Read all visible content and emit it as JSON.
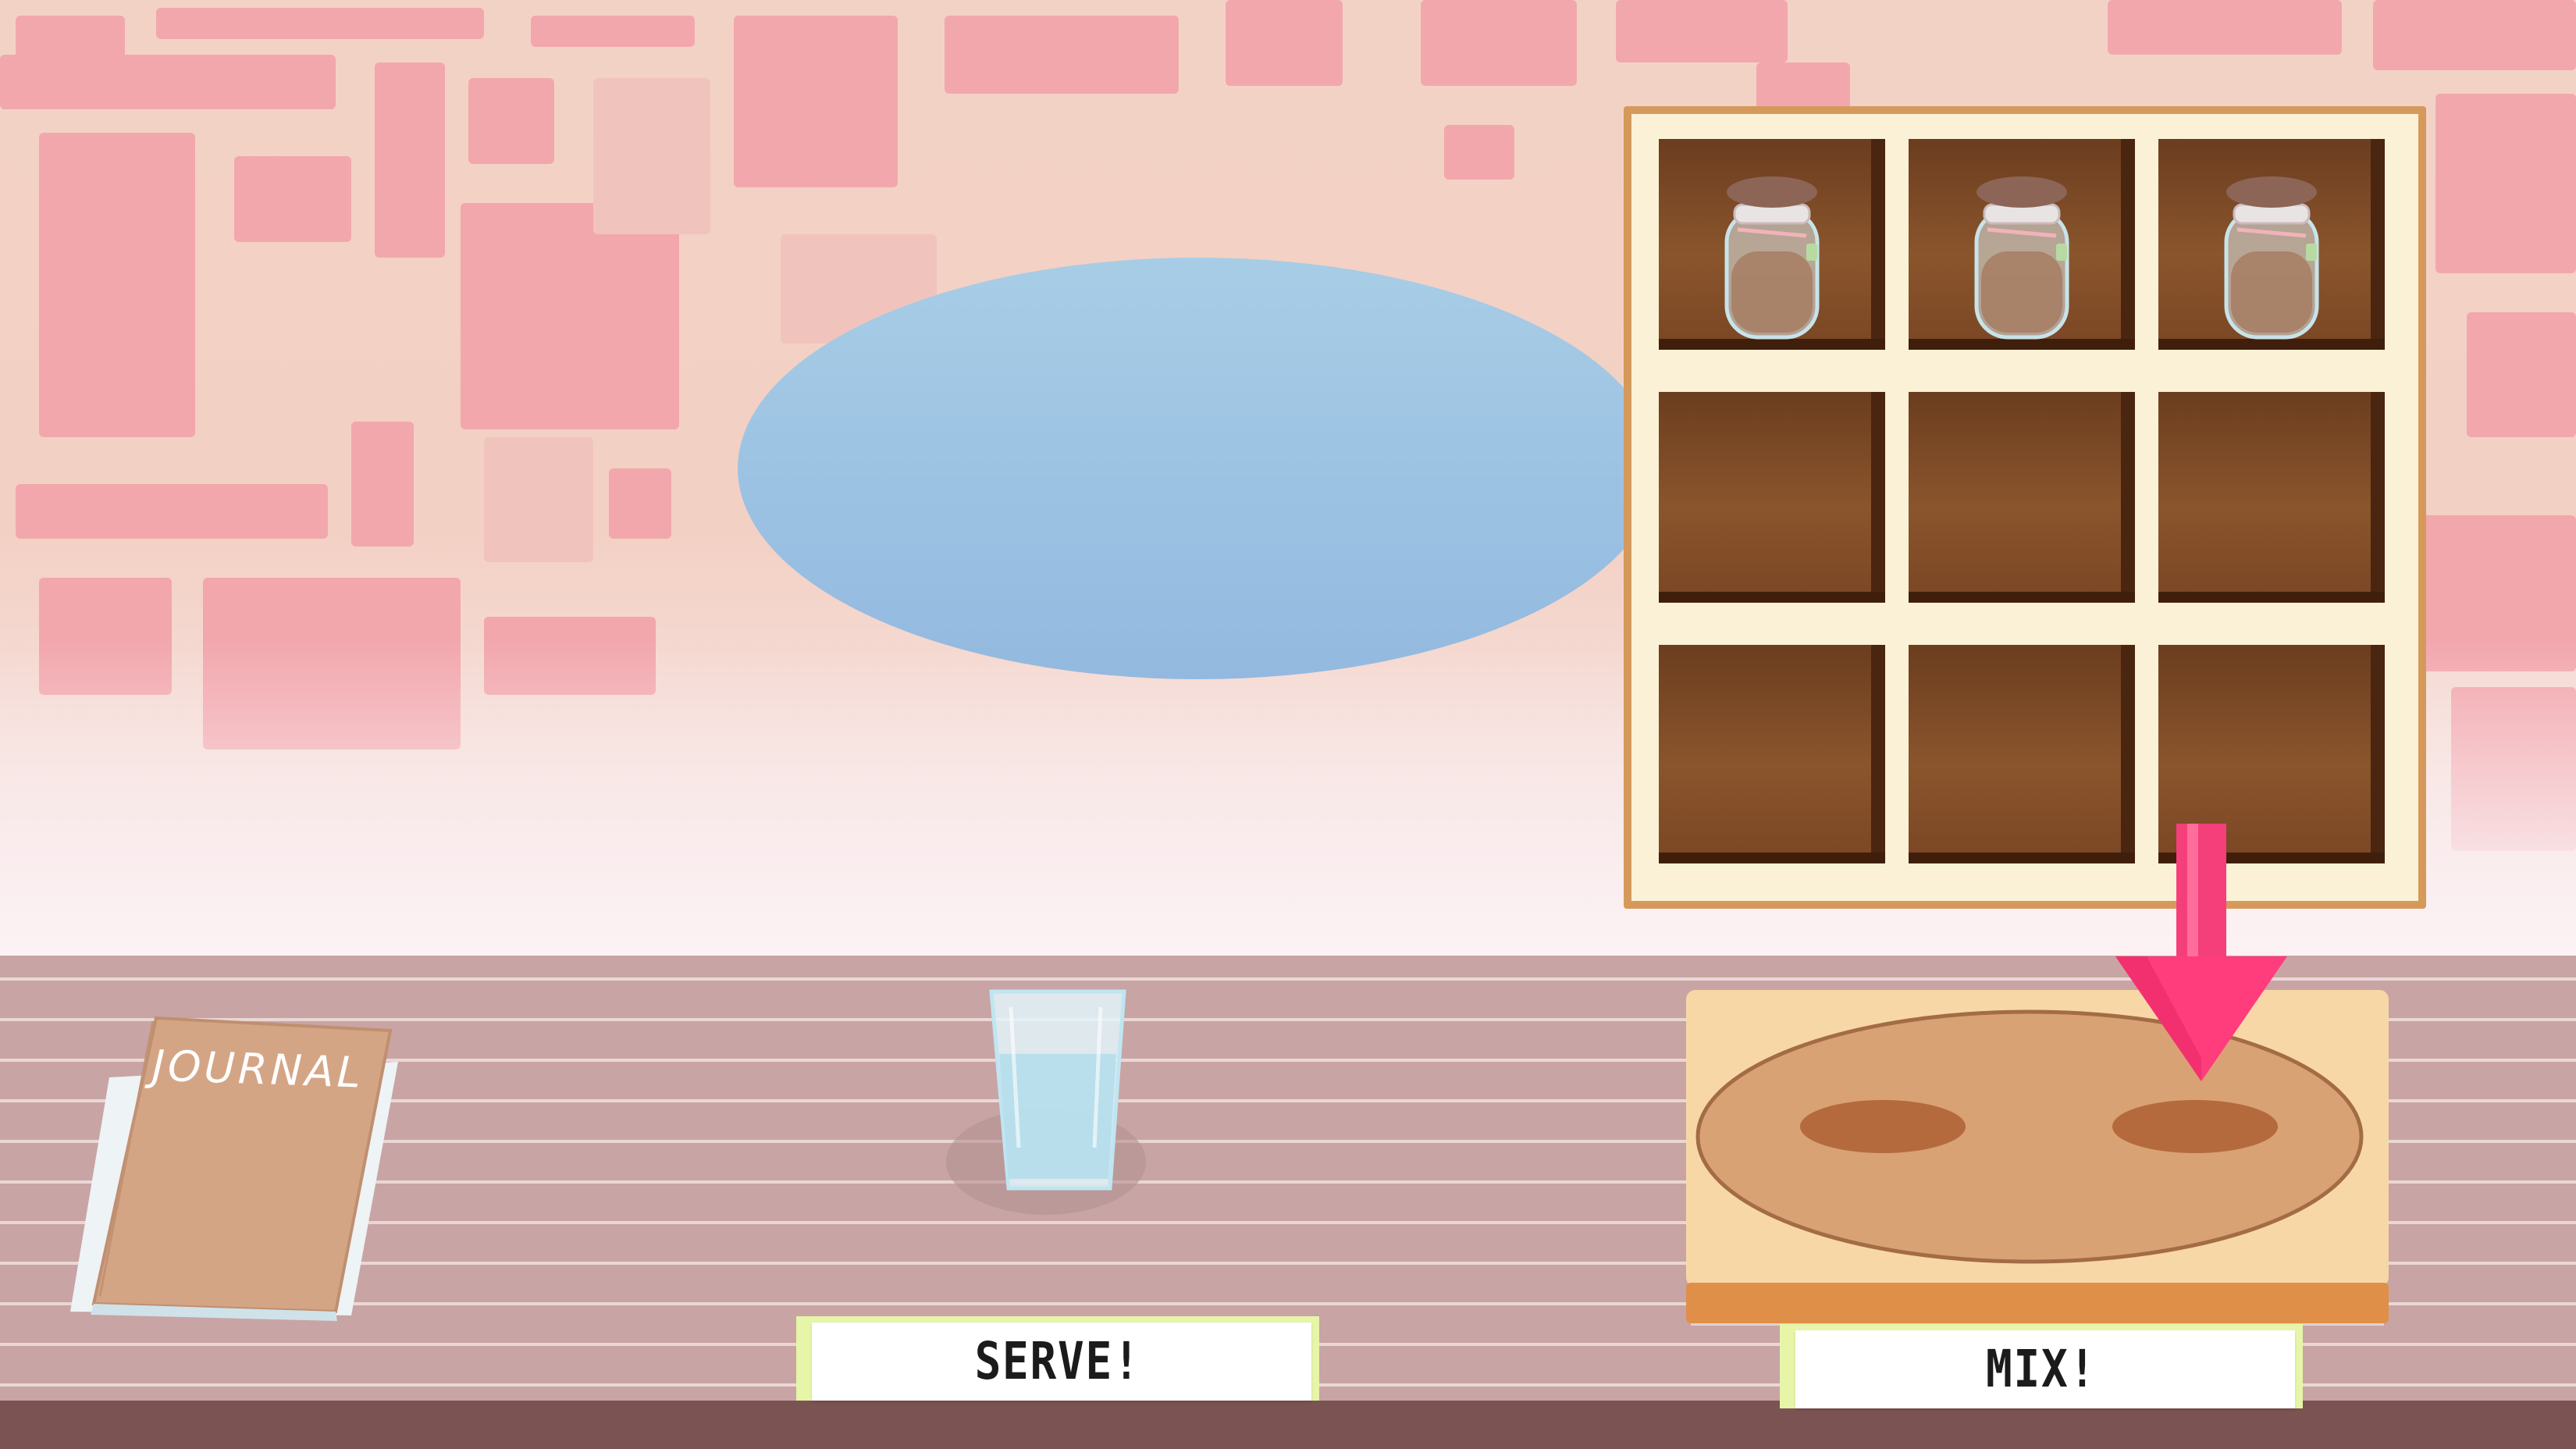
{
  "journal": {
    "title": "JOURNAL"
  },
  "buttons": {
    "serve": "SERVE!",
    "mix": "MIX!"
  },
  "shelf": {
    "rows": 3,
    "cols": 3,
    "jars_in_top_row": 3
  },
  "colors": {
    "wall_tile": "#f2a7ad",
    "window": "#9ac3e3",
    "table": "#c8a4a4",
    "shelf_frame": "#d59a5b",
    "arrow": "#ff3c7c",
    "button_tape": "#e6f5a8"
  }
}
